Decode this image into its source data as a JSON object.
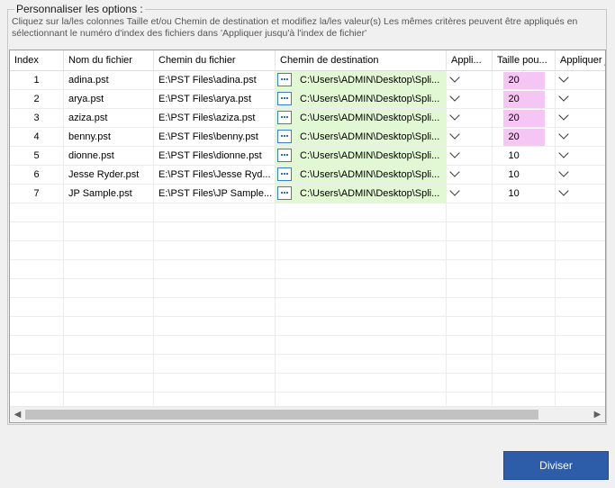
{
  "options": {
    "title": "Personnaliser les options :",
    "description_line1": "Cliquez sur la/les colonnes Taille et/ou Chemin de destination et modifiez la/les valeur(s) Les mêmes critères peuvent être appliqués en",
    "description_line2": "sélectionnant le numéro d'index des fichiers dans  'Appliquer jusqu'à l'index de fichier'"
  },
  "grid": {
    "columns": {
      "index": "Index",
      "name": "Nom du fichier",
      "path": "Chemin du fichier",
      "dest": "Chemin de destination",
      "apply": "Appli...",
      "size": "Taille pou...",
      "apply_to": "Appliquer j"
    },
    "rows": [
      {
        "index": "1",
        "name": "adina.pst",
        "path": "E:\\PST Files\\adina.pst",
        "dest": "C:\\Users\\ADMIN\\Desktop\\Spli...",
        "size": "20",
        "size_highlight": true
      },
      {
        "index": "2",
        "name": "arya.pst",
        "path": "E:\\PST Files\\arya.pst",
        "dest": "C:\\Users\\ADMIN\\Desktop\\Spli...",
        "size": "20",
        "size_highlight": true
      },
      {
        "index": "3",
        "name": "aziza.pst",
        "path": "E:\\PST Files\\aziza.pst",
        "dest": "C:\\Users\\ADMIN\\Desktop\\Spli...",
        "size": "20",
        "size_highlight": true
      },
      {
        "index": "4",
        "name": "benny.pst",
        "path": "E:\\PST Files\\benny.pst",
        "dest": "C:\\Users\\ADMIN\\Desktop\\Spli...",
        "size": "20",
        "size_highlight": true
      },
      {
        "index": "5",
        "name": "dionne.pst",
        "path": "E:\\PST Files\\dionne.pst",
        "dest": "C:\\Users\\ADMIN\\Desktop\\Spli...",
        "size": "10",
        "size_highlight": false
      },
      {
        "index": "6",
        "name": "Jesse Ryder.pst",
        "path": "E:\\PST Files\\Jesse Ryd...",
        "dest": "C:\\Users\\ADMIN\\Desktop\\Spli...",
        "size": "10",
        "size_highlight": false
      },
      {
        "index": "7",
        "name": "JP Sample.pst",
        "path": "E:\\PST Files\\JP Sample...",
        "dest": "C:\\Users\\ADMIN\\Desktop\\Spli...",
        "size": "10",
        "size_highlight": false
      }
    ],
    "scroll_left_icon": "chevron-left-icon",
    "scroll_right_icon": "chevron-right-icon"
  },
  "footer": {
    "split_button_label": "Diviser"
  },
  "colors": {
    "dest_bg": "#e2f8d4",
    "size_highlight_bg": "#f5c6f3",
    "primary_button": "#2d5da8"
  }
}
